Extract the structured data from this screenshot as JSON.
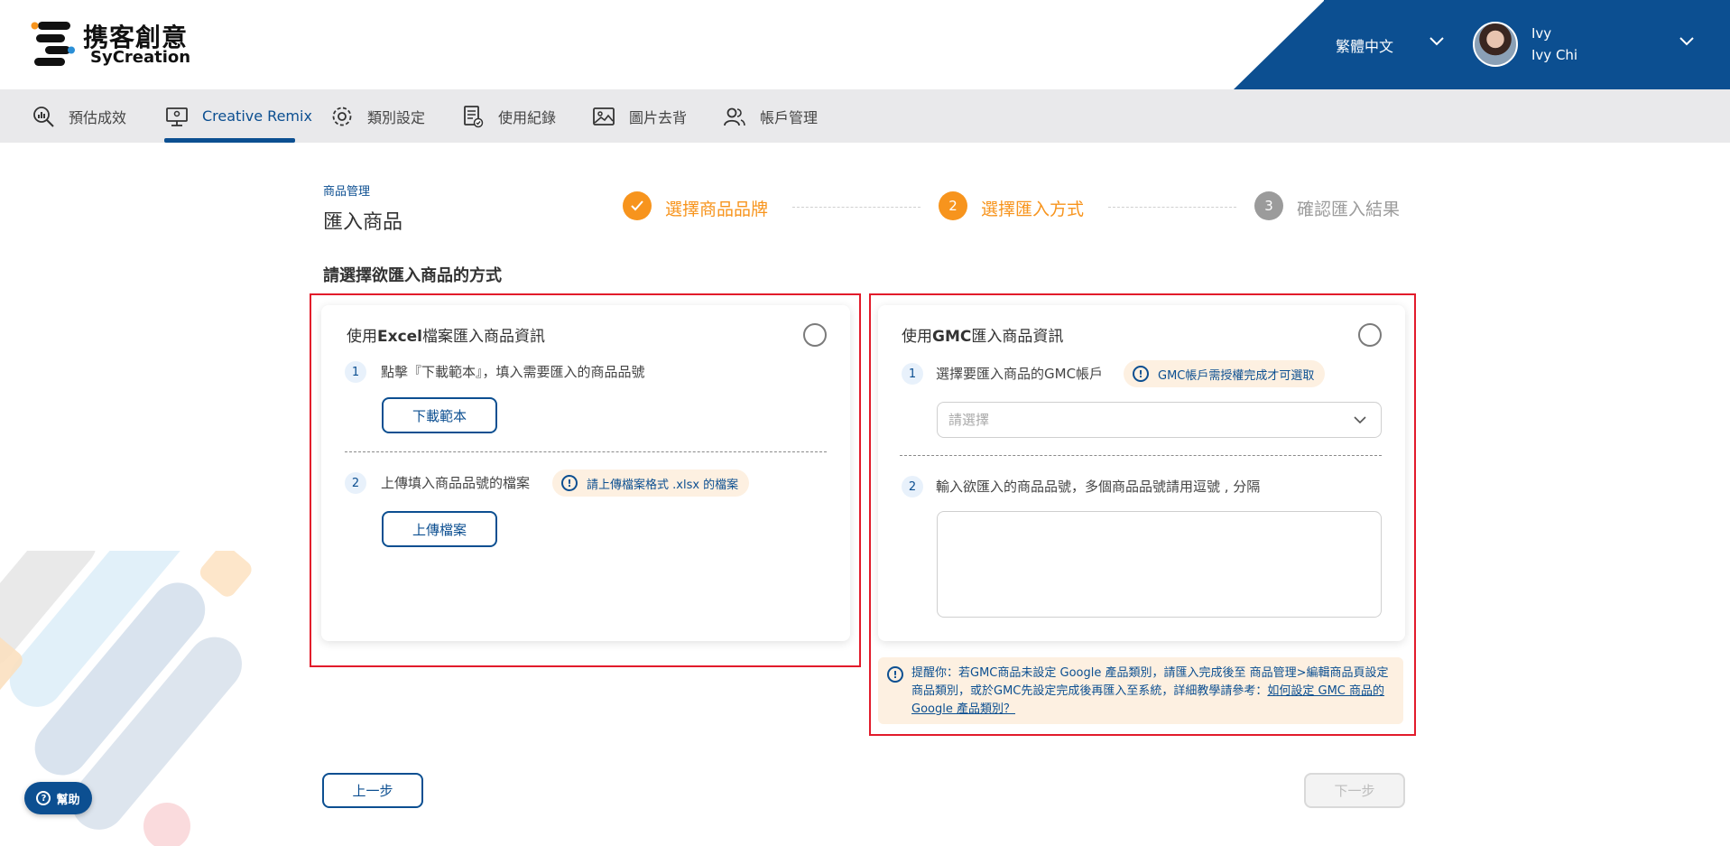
{
  "brand": {
    "name_cn": "携客創意",
    "name_en": "SyCreation"
  },
  "header": {
    "language": "繁體中文",
    "user_short": "Ivy",
    "user_full": "Ivy Chi",
    "color": "#0c4f91"
  },
  "nav": {
    "items": [
      {
        "label": "預估成效",
        "icon": "analytics-icon"
      },
      {
        "label": "Creative Remix",
        "icon": "computer-display-icon",
        "active": true
      },
      {
        "label": "類別設定",
        "icon": "gear-icon"
      },
      {
        "label": "使用紀錄",
        "icon": "document-check-icon"
      },
      {
        "label": "圖片去背",
        "icon": "image-icon"
      },
      {
        "label": "帳戶管理",
        "icon": "users-icon"
      }
    ]
  },
  "page": {
    "breadcrumb": "商品管理",
    "title": "匯入商品",
    "section_title": "請選擇欲匯入商品的方式"
  },
  "stepper": {
    "steps": [
      {
        "label": "選擇商品品牌",
        "state": "done"
      },
      {
        "label": "選擇匯入方式",
        "number": "2",
        "state": "active"
      },
      {
        "label": "確認匯入結果",
        "number": "3",
        "state": "pending"
      }
    ],
    "active_color": "#f7941d",
    "pending_color": "#9b9b9b"
  },
  "excel_card": {
    "title_prefix": "使用",
    "title_bold": "Excel",
    "title_suffix": "檔案匯入商品資訊",
    "step1_num": "1",
    "step1_text": "點擊『下載範本』，填入需要匯入的商品品號",
    "download_button": "下載範本",
    "step2_num": "2",
    "step2_text": "上傳填入商品品號的檔案",
    "step2_hint": "請上傳檔案格式 .xlsx 的檔案",
    "upload_button": "上傳檔案"
  },
  "gmc_card": {
    "title_prefix": "使用",
    "title_bold": "GMC",
    "title_suffix": "匯入商品資訊",
    "step1_num": "1",
    "step1_text": "選擇要匯入商品的GMC帳戶",
    "step1_hint": "GMC帳戶需授權完成才可選取",
    "select_placeholder": "請選擇",
    "step2_num": "2",
    "step2_text": "輸入欲匯入的商品品號，多個商品品號請用逗號 , 分隔",
    "textarea_value": ""
  },
  "notice": {
    "text": "提醒你：若GMC商品未設定 Google 產品類別，請匯入完成後至 商品管理>編輯商品頁設定商品類別，或於GMC先設定完成後再匯入至系統，詳細教學請參考：",
    "link": "如何設定 GMC 商品的 Google 產品類別？"
  },
  "footer": {
    "prev_button": "上一步",
    "next_button": "下一步",
    "help_button": "幫助"
  },
  "highlight_color": "#e21b2b"
}
